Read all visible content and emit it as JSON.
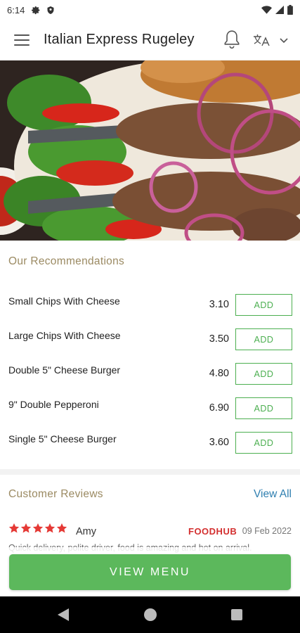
{
  "status_bar": {
    "time": "6:14",
    "icons": [
      "gear-icon",
      "shield-icon",
      "wifi-icon",
      "signal-icon",
      "battery-icon"
    ]
  },
  "app_bar": {
    "title": "Italian Express Rugeley",
    "icons": [
      "menu-icon",
      "bell-icon",
      "language-icon",
      "chevron-down-icon"
    ]
  },
  "hero": {
    "image": "kebab skewers with onion rings and salad"
  },
  "recommendations": {
    "title": "Our Recommendations",
    "items": [
      {
        "name": "Small Chips With Cheese",
        "price": "3.10",
        "add_label": "ADD"
      },
      {
        "name": "Large Chips With Cheese",
        "price": "3.50",
        "add_label": "ADD"
      },
      {
        "name": "Double 5\" Cheese Burger",
        "price": "4.80",
        "add_label": "ADD"
      },
      {
        "name": "9\" Double Pepperoni",
        "price": "6.90",
        "add_label": "ADD"
      },
      {
        "name": "Single 5\" Cheese Burger",
        "price": "3.60",
        "add_label": "ADD"
      }
    ]
  },
  "reviews": {
    "title": "Customer Reviews",
    "view_all_label": "View All",
    "items": [
      {
        "rating": 5,
        "reviewer": "Amy",
        "source": "FOODHUB",
        "date": "09 Feb 2022",
        "text": "Quick delivery, polite driver, food is amazing and hot on arrival."
      }
    ]
  },
  "cta": {
    "label": "VIEW MENU"
  },
  "colors": {
    "accent_green": "#5cb85c",
    "add_border": "#4caf50",
    "section_title": "#9b8a62",
    "link_blue": "#2f7fb0",
    "star_red": "#e53935",
    "brand_red": "#d32f2f"
  }
}
